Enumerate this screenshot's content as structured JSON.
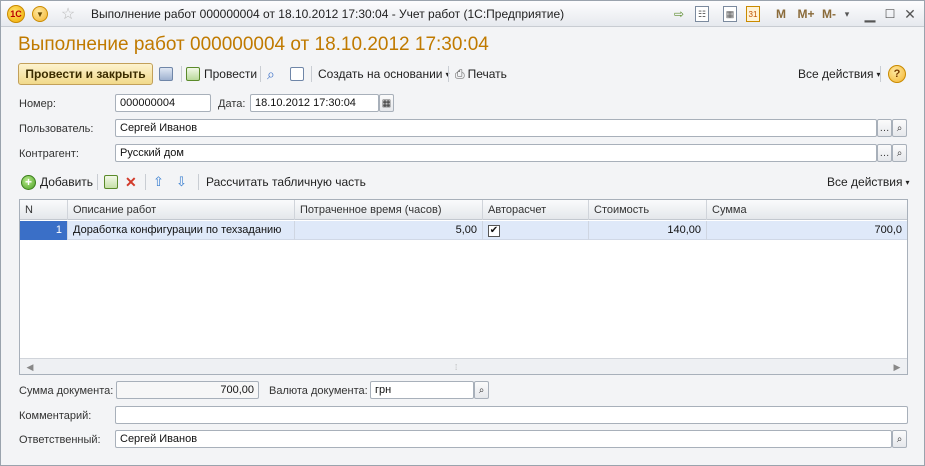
{
  "window": {
    "title": "Выполнение работ 000000004 от 18.10.2012 17:30:04 - Учет работ  (1С:Предприятие)",
    "logo_text": "1С",
    "right_controls": [
      "M",
      "M+",
      "M-"
    ]
  },
  "form": {
    "title": "Выполнение работ 000000004 от 18.10.2012 17:30:04"
  },
  "toolbar": {
    "post_close_label": "Провести и закрыть",
    "post_label": "Провести",
    "create_based_label": "Создать на основании",
    "print_label": "Печать",
    "all_actions_label": "Все действия",
    "help_label": "?"
  },
  "fields": {
    "number_label": "Номер:",
    "number_value": "000000004",
    "date_label": "Дата:",
    "date_value": "18.10.2012 17:30:04",
    "user_label": "Пользователь:",
    "user_value": "Сергей Иванов",
    "counterparty_label": "Контрагент:",
    "counterparty_value": "Русский дом"
  },
  "table_toolbar": {
    "add_label": "Добавить",
    "calculate_label": "Рассчитать табличную часть",
    "all_actions_label": "Все действия"
  },
  "table": {
    "columns": [
      "N",
      "Описание работ",
      "Потраченное время (часов)",
      "Авторасчет",
      "Стоимость",
      "Сумма"
    ],
    "rows": [
      {
        "n": "1",
        "description": "Доработка конфигурации по техзаданию",
        "hours": "5,00",
        "autocalc": true,
        "cost": "140,00",
        "sum": "700,0"
      }
    ]
  },
  "footer": {
    "sum_label": "Сумма документа:",
    "sum_value": "700,00",
    "currency_label": "Валюта документа:",
    "currency_value": "грн",
    "comment_label": "Комментарий:",
    "comment_value": "",
    "responsible_label": "Ответственный:",
    "responsible_value": "Сергей Иванов"
  },
  "colors": {
    "title_accent": "#c07a00",
    "selected_row": "#dfe9f9",
    "selected_cell": "#3a6fc7",
    "primary_button": "#f1d98a"
  },
  "icons": [
    "menu-icon",
    "star-icon",
    "save-icon",
    "post-icon",
    "preview-icon",
    "structure-icon",
    "print-icon",
    "calendar-icon",
    "search-icon",
    "copy-icon",
    "delete-icon",
    "arrow-up-icon",
    "arrow-down-icon"
  ]
}
